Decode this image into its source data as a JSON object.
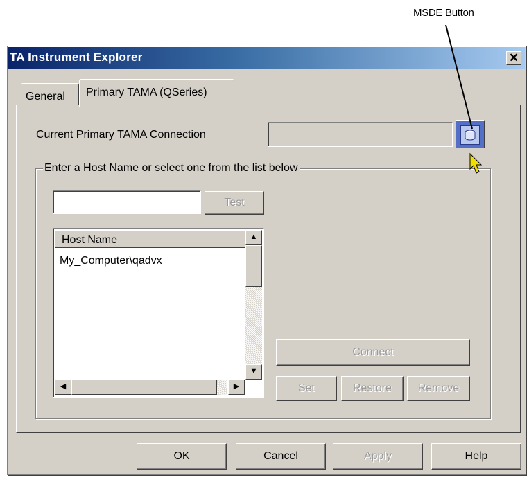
{
  "callout": {
    "label": "MSDE Button"
  },
  "window": {
    "title": "TA Instrument Explorer",
    "close_glyph": "✕"
  },
  "tabs": [
    {
      "label": "General",
      "active": false
    },
    {
      "label": "Primary TAMA (QSeries)",
      "active": true
    }
  ],
  "connection": {
    "label": "Current Primary TAMA Connection",
    "value": ""
  },
  "msde_button": {
    "icon": "database-icon"
  },
  "host_group": {
    "legend": "Enter a Host Name or select one from the list below",
    "input_value": "",
    "test_label": "Test",
    "list_header": "Host Name",
    "hosts": [
      "My_Computer\\qadvx"
    ],
    "faded_rows": [
      "",
      "",
      "",
      "",
      "",
      "",
      "",
      ""
    ]
  },
  "action_buttons": {
    "connect": "Connect",
    "set": "Set",
    "restore": "Restore",
    "remove": "Remove"
  },
  "footer": {
    "ok": "OK",
    "cancel": "Cancel",
    "apply": "Apply",
    "help": "Help"
  },
  "colors": {
    "title_start": "#0a246a",
    "title_end": "#a6caf0",
    "face": "#d4d0c8",
    "cursor": "#f0e000"
  }
}
